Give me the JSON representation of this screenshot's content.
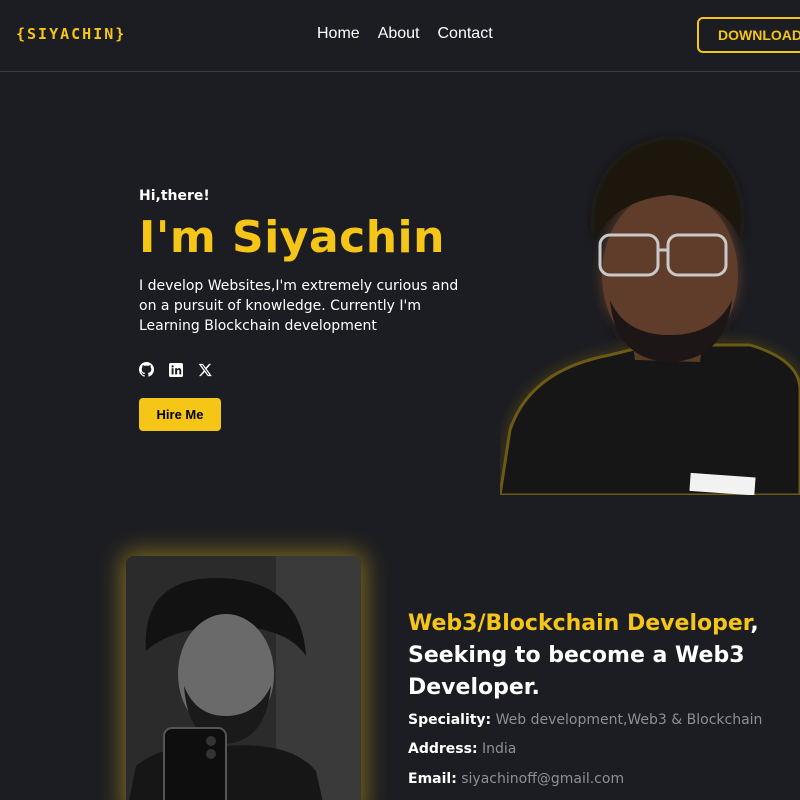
{
  "nav": {
    "logo": "{SIYACHIN}",
    "links": [
      "Home",
      "About",
      "Contact"
    ],
    "download_label": "DOWNLOAD CV"
  },
  "hero": {
    "greeting": "Hi,there!",
    "title": "I'm Siyachin",
    "description": "I develop Websites,I'm extremely curious and on a pursuit of knowledge. Currently I'm Learning Blockchain development",
    "socials": [
      "github-icon",
      "linkedin-icon",
      "x-icon"
    ],
    "hire_label": "Hire Me"
  },
  "about": {
    "heading_highlight": "Web3/Blockchain Developer",
    "heading_rest": ", Seeking to become a Web3 Developer.",
    "info": [
      {
        "label": "Speciality:",
        "value": "Web development,Web3 & Blockchain"
      },
      {
        "label": "Address:",
        "value": "India"
      },
      {
        "label": "Email:",
        "value": "siyachinoff@gmail.com"
      }
    ]
  },
  "colors": {
    "accent": "#f5c518",
    "background": "#1c1d22",
    "muted": "#8e8f95"
  }
}
